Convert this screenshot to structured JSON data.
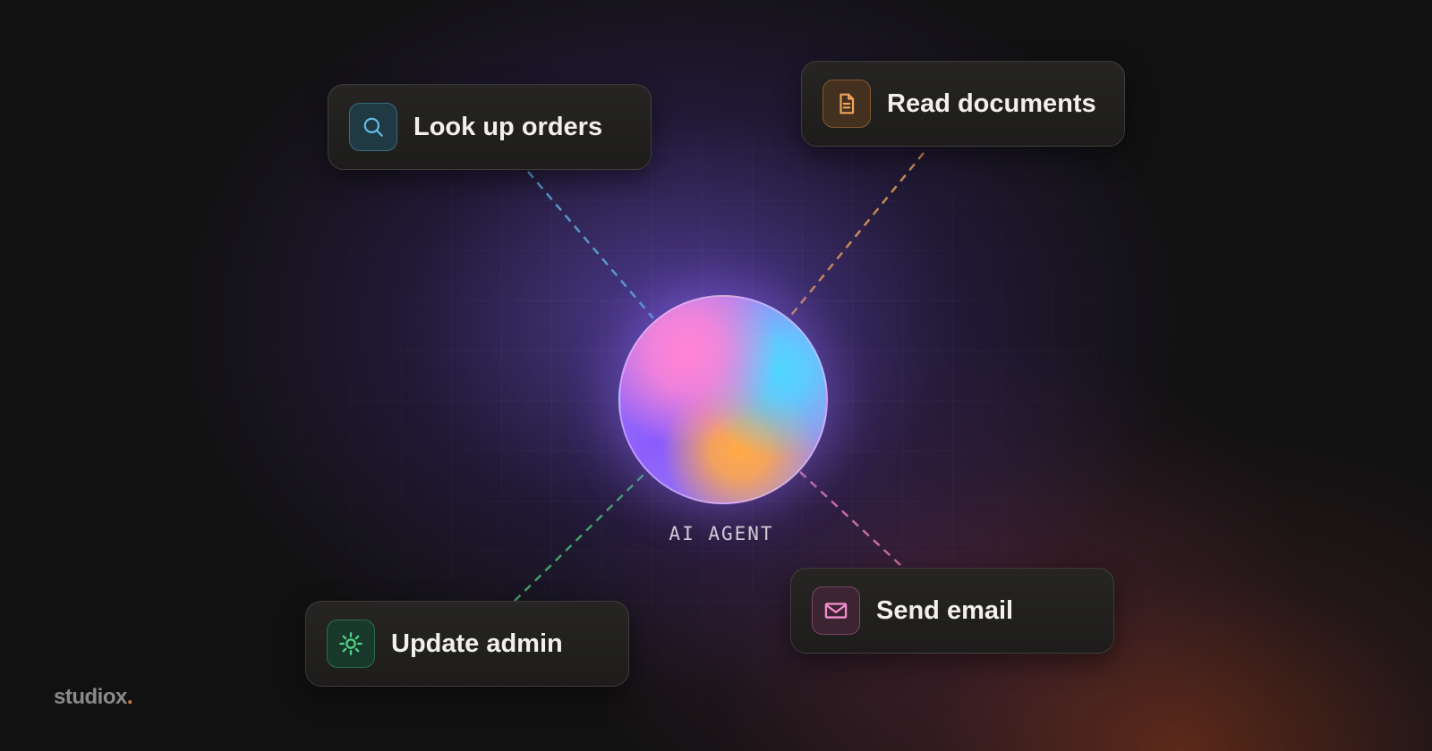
{
  "colors": {
    "lookup_accent": "#5aa6d6",
    "read_accent": "#d8925a",
    "update_accent": "#4fbf7c",
    "email_accent": "#e07ab6",
    "brand_dot": "#e07a3c"
  },
  "agent": {
    "label": "AI AGENT"
  },
  "tools": [
    {
      "label": "Look up orders",
      "icon": "search-icon"
    },
    {
      "label": "Read documents",
      "icon": "document-icon"
    },
    {
      "label": "Update admin",
      "icon": "gear-icon"
    },
    {
      "label": "Send email",
      "icon": "mail-icon"
    }
  ],
  "brand": {
    "name": "studiox",
    "dot": "."
  }
}
